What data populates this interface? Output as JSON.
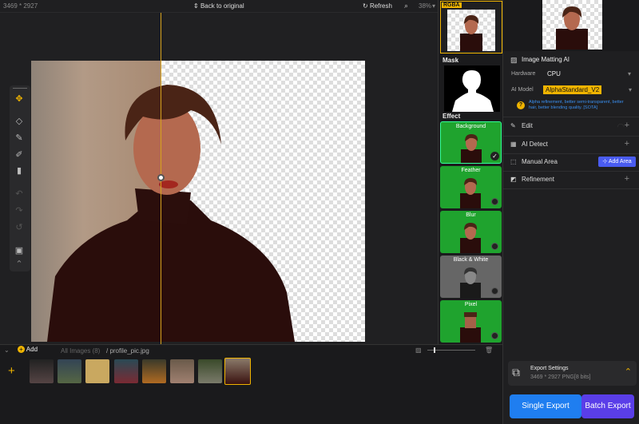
{
  "topbar": {
    "dimensions": "3469 * 2927",
    "back_label": "Back to original",
    "refresh_label": "Refresh",
    "zoom": "38%"
  },
  "effects": {
    "rgba_label": "RGBA",
    "mask_label": "Mask",
    "effect_label": "Effect",
    "items": [
      {
        "label": "Background",
        "selected": true
      },
      {
        "label": "Feather",
        "selected": false
      },
      {
        "label": "Blur",
        "selected": false
      },
      {
        "label": "Black & White",
        "selected": false
      },
      {
        "label": "Pixel",
        "selected": false
      }
    ]
  },
  "panel": {
    "matting_title": "Image Matting AI",
    "hardware_label": "Hardware",
    "hardware_value": "CPU",
    "model_label": "AI Model",
    "model_value": "AlphaStandard_V2",
    "model_desc": "Alpha refinement, better semi-transparent, better hair, better blending quality. [SOTA]",
    "edit_label": "Edit",
    "detect_label": "AI Detect",
    "manual_label": "Manual Area",
    "add_area_label": "Add Area",
    "refine_label": "Refinement",
    "export_title": "Export Settings",
    "export_info": "3469 * 2927 PNG[8 bits]",
    "single_export": "Single Export",
    "batch_export": "Batch Export"
  },
  "strip": {
    "add_label": "Add",
    "all_images": "All Images (8)",
    "path": "/ profile_pic.jpg"
  },
  "colors": {
    "accent": "#f0b400",
    "blue": "#1f7ef0",
    "purple": "#5a3ee8",
    "green": "#1fa32e"
  }
}
